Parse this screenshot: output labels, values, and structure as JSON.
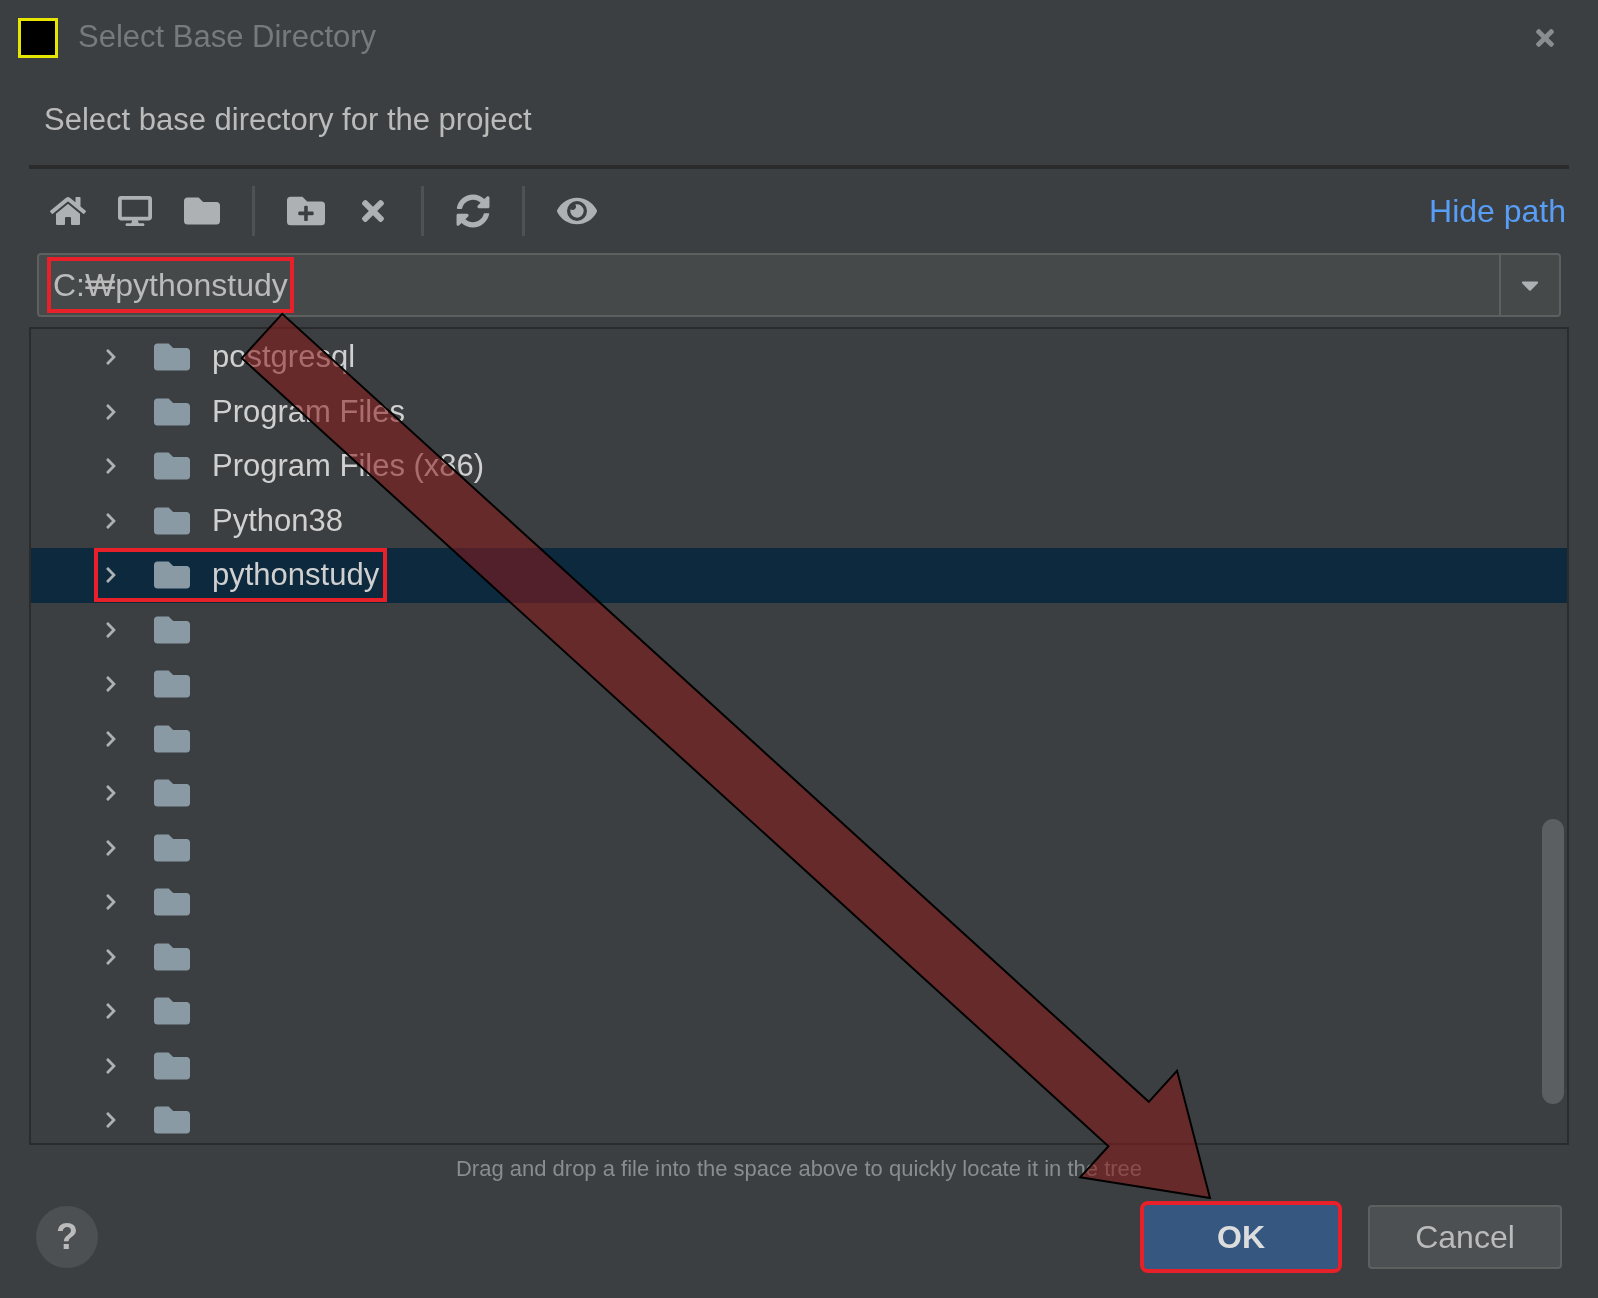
{
  "window": {
    "title": "Select Base Directory"
  },
  "prompt": "Select base directory for the project",
  "toolbar": {
    "hide_path_link": "Hide path"
  },
  "path_field": {
    "value": "C:₩pythonstudy",
    "highlighted": true
  },
  "tree": {
    "items": [
      {
        "label": "postgresql",
        "selected": false,
        "highlighted": false
      },
      {
        "label": "Program Files",
        "selected": false,
        "highlighted": false
      },
      {
        "label": "Program Files (x86)",
        "selected": false,
        "highlighted": false
      },
      {
        "label": "Python38",
        "selected": false,
        "highlighted": false
      },
      {
        "label": "pythonstudy",
        "selected": true,
        "highlighted": true
      },
      {
        "selected": false,
        "highlighted": false
      },
      {
        "selected": false,
        "highlighted": false
      },
      {
        "selected": false,
        "highlighted": false
      },
      {
        "selected": false,
        "highlighted": false
      },
      {
        "selected": false,
        "highlighted": false
      },
      {
        "selected": false,
        "highlighted": false
      },
      {
        "selected": false,
        "highlighted": false
      },
      {
        "selected": false,
        "highlighted": false
      },
      {
        "selected": false,
        "highlighted": false
      },
      {
        "selected": false,
        "highlighted": false
      }
    ]
  },
  "hint": "Drag and drop a file into the space above to quickly locate it in the tree",
  "buttons": [
    {
      "label": "OK",
      "kind": "primary",
      "highlighted": true
    },
    {
      "label": "Cancel",
      "kind": "secondary",
      "highlighted": false
    }
  ],
  "help_button": "?"
}
